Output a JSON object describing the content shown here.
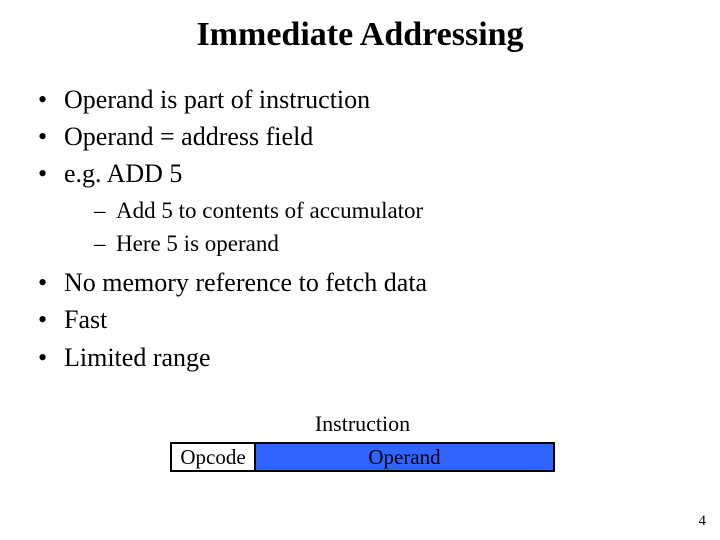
{
  "title": "Immediate Addressing",
  "bullets1": {
    "b0": "Operand is part of instruction",
    "b1": "Operand = address field",
    "b2": "e.g. ADD 5",
    "b3": "No memory reference to fetch data",
    "b4": "Fast",
    "b5": "Limited range"
  },
  "bullets2": {
    "s0": "Add 5 to contents of accumulator",
    "s1": "Here 5 is operand"
  },
  "diagram": {
    "label": "Instruction",
    "opcode": "Opcode",
    "operand": "Operand"
  },
  "page_number": "4"
}
